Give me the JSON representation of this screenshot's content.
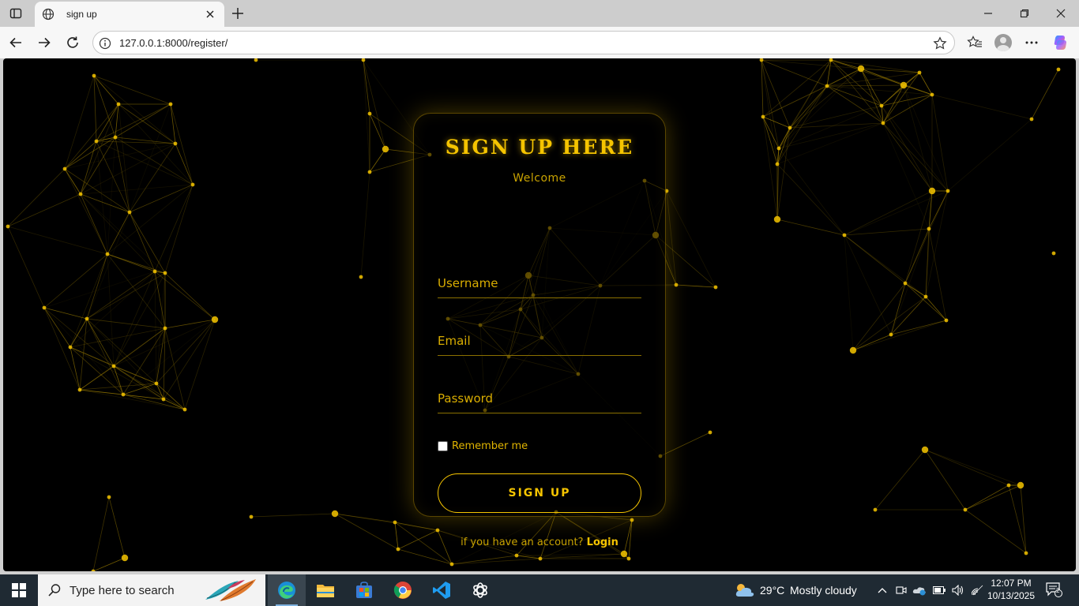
{
  "browser": {
    "tab_title": "sign up",
    "url": "127.0.0.1:8000/register/",
    "icons": [
      "sidebar-icon",
      "globe-icon",
      "close-icon",
      "new-tab-icon",
      "minimize-icon",
      "restore-icon",
      "window-close-icon",
      "back-icon",
      "forward-icon",
      "refresh-icon",
      "info-icon",
      "favorite-star-icon",
      "favorites-icon",
      "profile-icon",
      "more-icon",
      "copilot-icon"
    ]
  },
  "form": {
    "title": "SIGN UP HERE",
    "subtitle": "Welcome",
    "username_placeholder": "Username",
    "email_placeholder": "Email",
    "password_placeholder": "Password",
    "remember_label": "Remember me",
    "remember_checked": false,
    "submit_label": "SIGN UP",
    "login_prompt": "if you have an account?",
    "login_link": "Login"
  },
  "colors": {
    "accent": "#f5c400",
    "background": "#000000",
    "network_line": "#b89400"
  },
  "taskbar": {
    "search_placeholder": "Type here to search",
    "weather_temp": "29°C",
    "weather_text": "Mostly cloudy",
    "time": "12:07 PM",
    "date": "10/13/2025",
    "notification_count": "2",
    "apps": [
      "edge-icon",
      "file-explorer-icon",
      "store-icon",
      "chrome-icon",
      "vscode-icon",
      "chatgpt-icon"
    ]
  }
}
